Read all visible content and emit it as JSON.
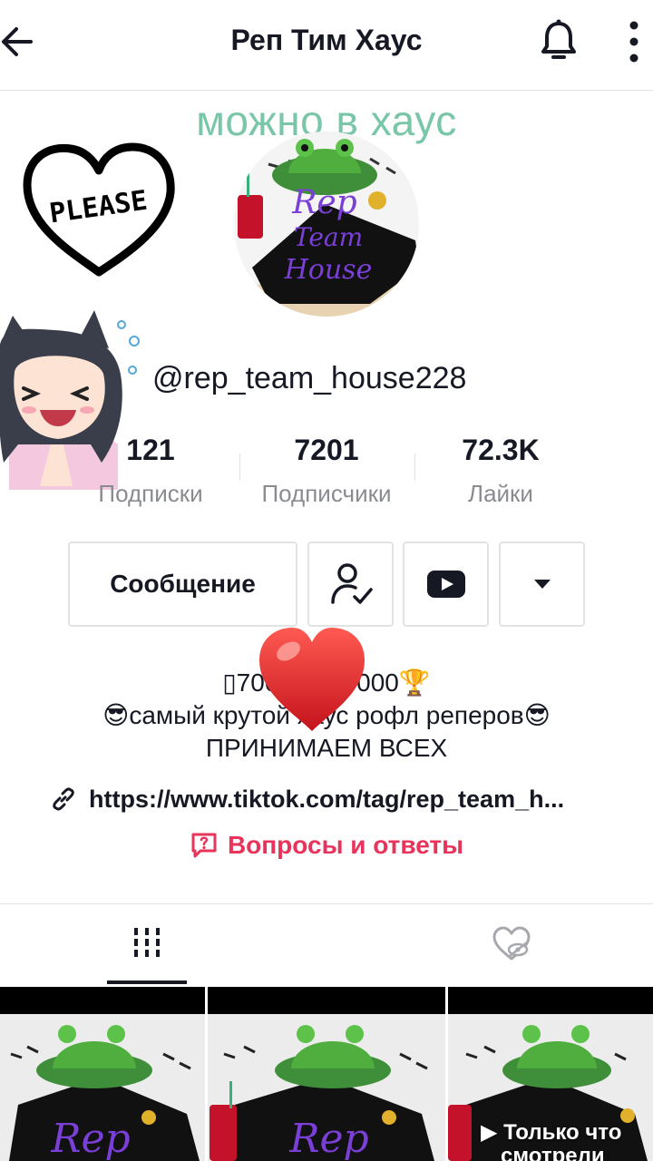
{
  "header": {
    "title": "Реп Тим Хаус",
    "back_icon": "arrow-left-icon",
    "bell_icon": "bell-icon",
    "more_icon": "more-vertical-icon"
  },
  "overlay": {
    "caption": "можно в хаус",
    "heart_sticker_text": "PLEASE"
  },
  "profile": {
    "username": "@rep_team_house228",
    "avatar_text": [
      "Rep",
      "Team",
      "House"
    ]
  },
  "stats": [
    {
      "value": "121",
      "label": "Подписки"
    },
    {
      "value": "7201",
      "label": "Подписчики"
    },
    {
      "value": "72.3K",
      "label": "Лайки"
    }
  ],
  "actions": {
    "message_label": "Сообщение",
    "follow_icon": "user-check-icon",
    "youtube_icon": "youtube-icon",
    "dropdown_icon": "caret-down-icon"
  },
  "bio": {
    "line1": "▯7000 ❤ 10000🏆",
    "line2": "😎самый крутой хаус рофл реперов😎",
    "line3": "ПРИНИМАЕМ ВСЕХ"
  },
  "link": {
    "text": "https://www.tiktok.com/tag/rep_team_h..."
  },
  "qa": {
    "label": "Вопросы и ответы"
  },
  "tabs": {
    "videos_icon": "grid-icon",
    "liked_icon": "hidden-heart-icon"
  },
  "grid": {
    "watched_label_line1": "Только что",
    "watched_label_line2": "смотрели",
    "video_text": "Rep"
  },
  "colors": {
    "accent": "#e8335a",
    "caption": "#79c6a8",
    "text": "#161823",
    "muted": "#8a8b91",
    "border": "#e3e3e4"
  }
}
